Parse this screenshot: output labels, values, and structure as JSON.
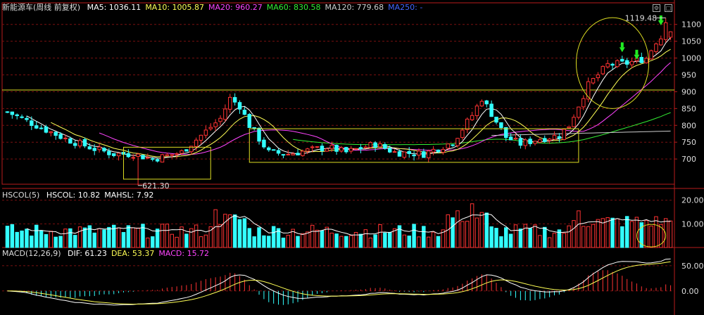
{
  "header": {
    "title": "新能源车(周线 前复权)",
    "ma": [
      {
        "label": "MA5: 1036.11",
        "color": "#ffffff"
      },
      {
        "label": "MA10: 1005.87",
        "color": "#ffff55"
      },
      {
        "label": "MA20: 960.27",
        "color": "#ff44ff"
      },
      {
        "label": "MA60: 830.58",
        "color": "#33ee33"
      },
      {
        "label": "MA120: 779.68",
        "color": "#cccccc"
      },
      {
        "label": "MA250: -",
        "color": "#4466ff"
      }
    ]
  },
  "volume_header": {
    "name": "HSCOL(5)",
    "items": [
      {
        "label": "HSCOL: 10.82",
        "color": "#ffffff"
      },
      {
        "label": "MAHSL: 7.92",
        "color": "#ffffff"
      }
    ]
  },
  "macd_header": {
    "name": "MACD(12,26,9)",
    "items": [
      {
        "label": "DIF: 61.23",
        "color": "#ffffff"
      },
      {
        "label": "DEA: 53.37",
        "color": "#ffff55"
      },
      {
        "label": "MACD: 15.72",
        "color": "#ff44ff"
      }
    ]
  },
  "annotations": {
    "high_label": "1119.48",
    "low_label": "621.30"
  },
  "colors": {
    "up": "#ff3333",
    "down": "#33ffff",
    "grid": "#7a1010",
    "axis": "#b81c1c",
    "yellow": "#dddd22",
    "ma5": "#ffffff",
    "ma10": "#ffff55",
    "ma20": "#ff44ff",
    "ma60": "#33ee33",
    "ma120": "#cccccc",
    "arrow": "#22ee22"
  },
  "chart_data": [
    {
      "type": "candlestick",
      "x": {
        "count": 138,
        "unit": "week"
      },
      "yticks": [
        700,
        750,
        800,
        850,
        900,
        950,
        1000,
        1050,
        1100
      ],
      "ylim": [
        625,
        1135
      ],
      "horizontal_line": 905,
      "keypoints": [
        [
          0,
          840
        ],
        [
          6,
          800
        ],
        [
          12,
          760
        ],
        [
          18,
          730
        ],
        [
          22,
          715
        ],
        [
          26,
          715
        ],
        [
          30,
          700
        ],
        [
          36,
          720
        ],
        [
          40,
          770
        ],
        [
          44,
          820
        ],
        [
          46,
          880
        ],
        [
          48,
          858
        ],
        [
          50,
          800
        ],
        [
          52,
          760
        ],
        [
          54,
          720
        ],
        [
          58,
          715
        ],
        [
          62,
          725
        ],
        [
          66,
          735
        ],
        [
          70,
          720
        ],
        [
          76,
          745
        ],
        [
          80,
          720
        ],
        [
          86,
          715
        ],
        [
          92,
          750
        ],
        [
          96,
          830
        ],
        [
          98,
          880
        ],
        [
          100,
          835
        ],
        [
          103,
          765
        ],
        [
          106,
          745
        ],
        [
          110,
          760
        ],
        [
          114,
          770
        ],
        [
          116,
          800
        ],
        [
          118,
          860
        ],
        [
          120,
          920
        ],
        [
          124,
          980
        ],
        [
          128,
          985
        ],
        [
          132,
          1000
        ],
        [
          134,
          1050
        ],
        [
          137,
          1082
        ]
      ],
      "high": 1119.48,
      "low": 621.3
    },
    {
      "type": "bar",
      "name": "HSCOL",
      "yticks": [
        10,
        20
      ],
      "ylim": [
        0,
        22
      ]
    },
    {
      "type": "line",
      "name": "MACD",
      "yticks": [
        0,
        50
      ],
      "ylim": [
        -45,
        75
      ]
    }
  ]
}
